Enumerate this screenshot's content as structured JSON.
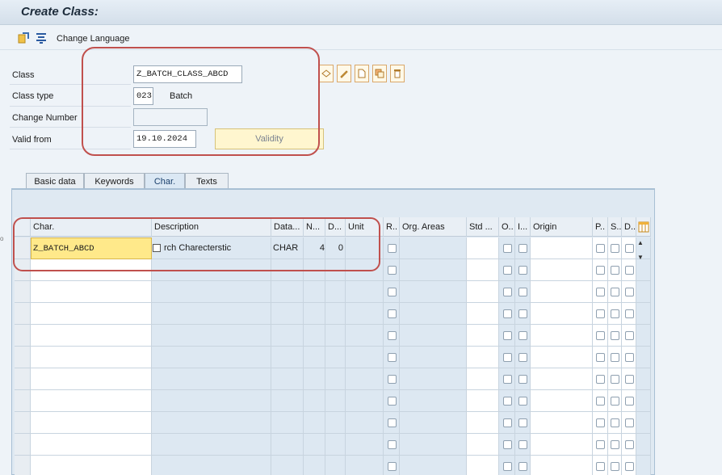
{
  "window": {
    "title": "Create Class:"
  },
  "toolbar": {
    "change_language_label": "Change Language"
  },
  "header": {
    "class_label": "Class",
    "class_value": "Z_BATCH_CLASS_ABCD",
    "class_type_label": "Class type",
    "class_type_value": "023",
    "class_type_text": "Batch",
    "change_number_label": "Change Number",
    "change_number_value": "",
    "valid_from_label": "Valid from",
    "valid_from_value": "19.10.2024",
    "validity_button": "Validity"
  },
  "tabs": [
    {
      "label": "Basic data"
    },
    {
      "label": "Keywords"
    },
    {
      "label": "Char.",
      "active": true
    },
    {
      "label": "Texts"
    }
  ],
  "table": {
    "columns": [
      "Char.",
      "Description",
      "Data...",
      "N...",
      "D...",
      "Unit",
      "R..",
      "Org. Areas",
      "Std ...",
      "O..",
      "I...",
      "Origin",
      "P..",
      "S..",
      "D.."
    ],
    "rows": [
      {
        "char": "Z_BATCH_ABCD",
        "description": "rch Charecterstic",
        "data_type": "CHAR",
        "num_chars": "4",
        "decimals": "0",
        "unit": ""
      }
    ]
  },
  "colors": {
    "accent": "#c0504d",
    "highlight": "#ffe98a"
  }
}
